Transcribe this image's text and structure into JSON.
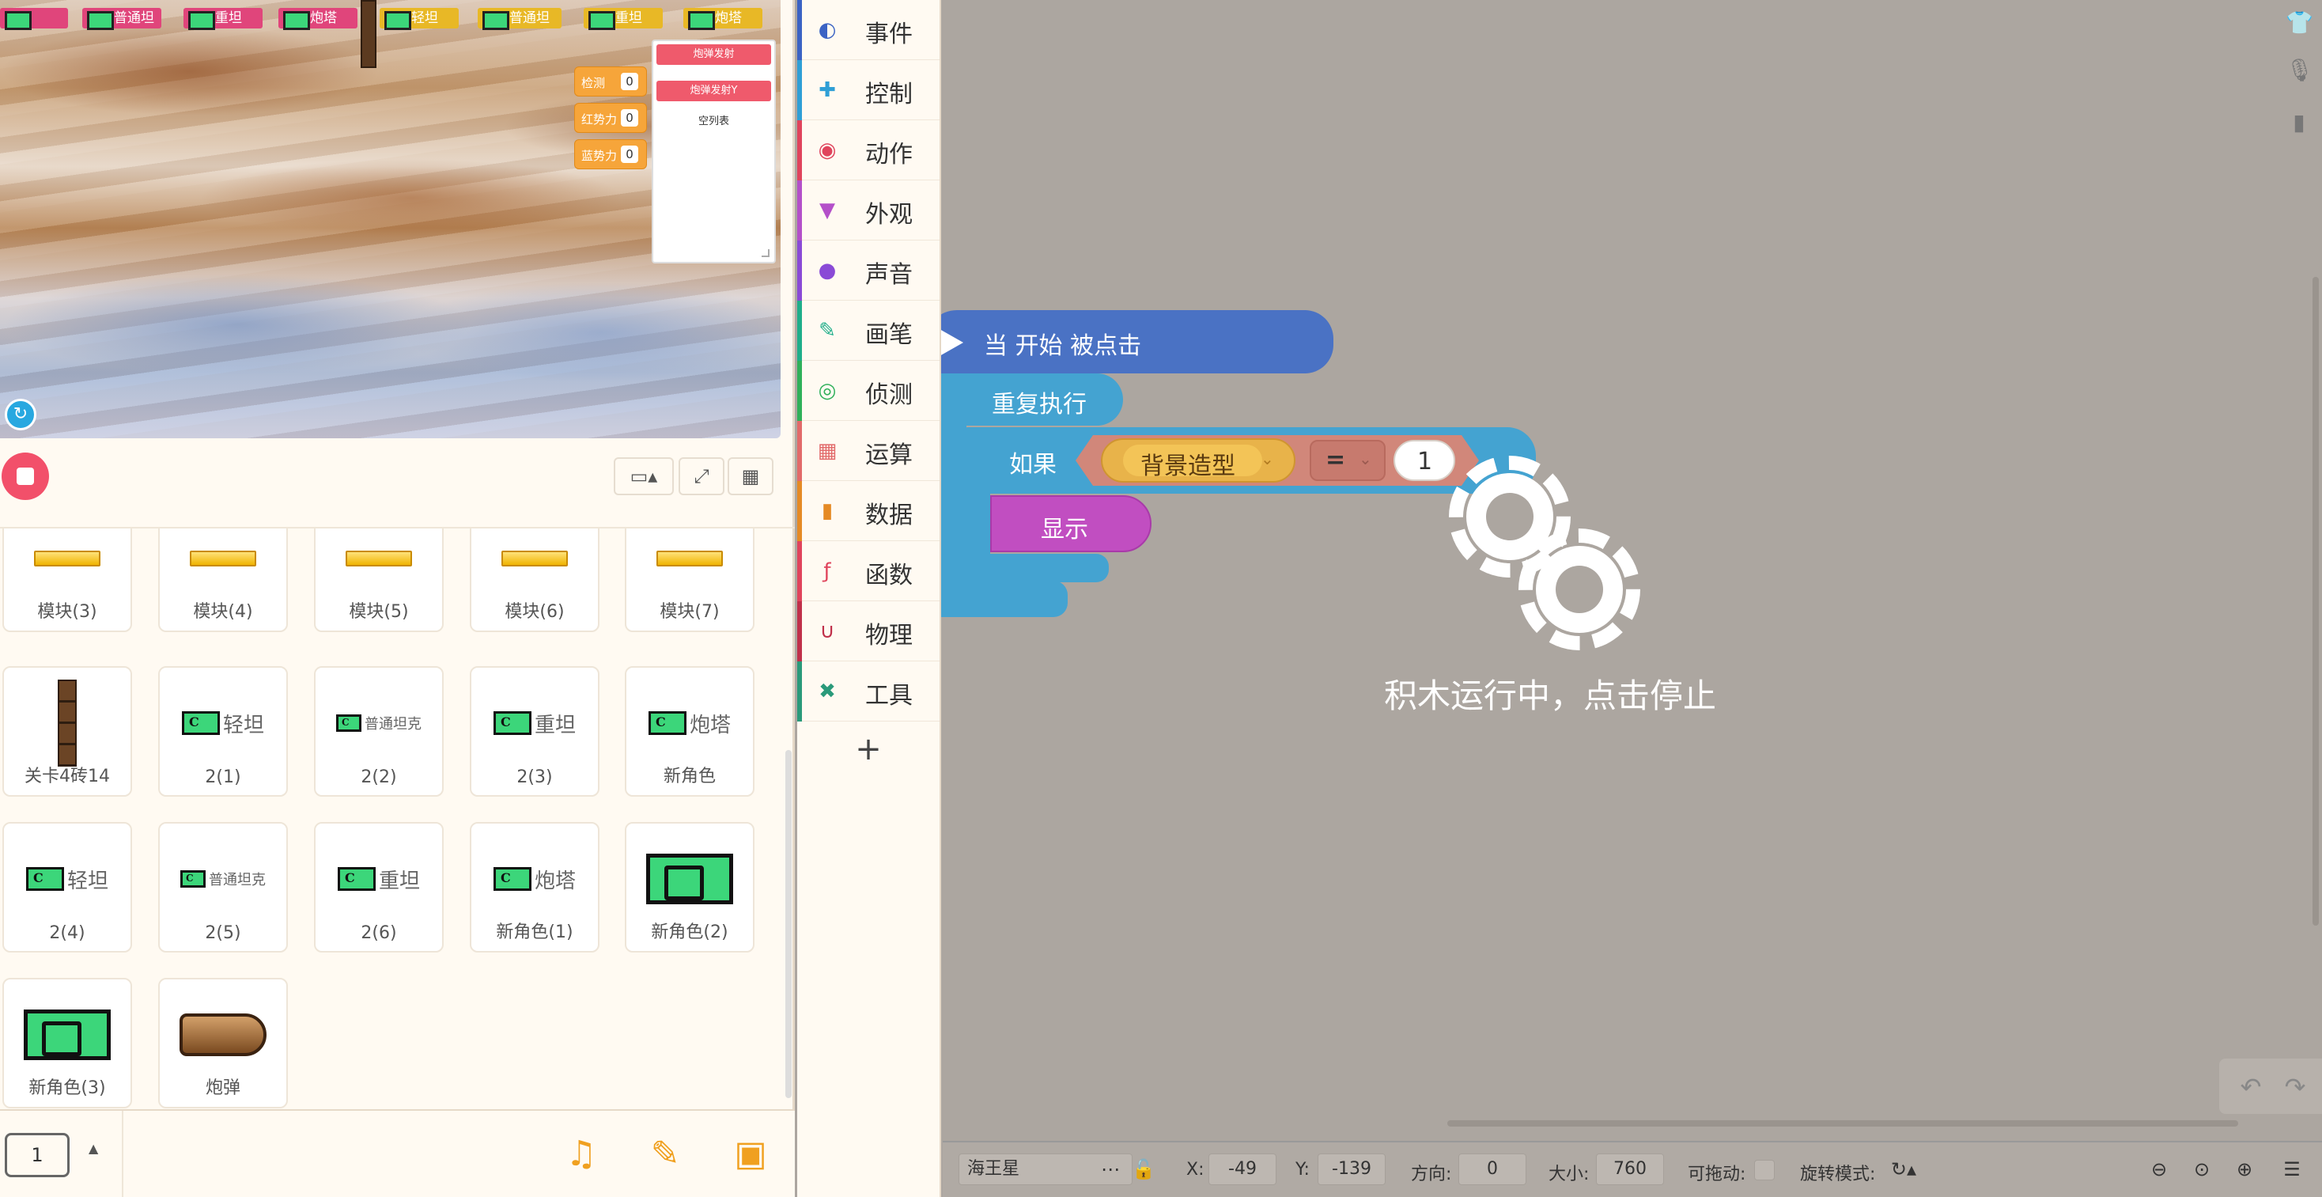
{
  "stage": {
    "top_sprites": [
      {
        "label": "",
        "style": "red"
      },
      {
        "label": "普通坦",
        "style": "red"
      },
      {
        "label": "重坦",
        "style": "red"
      },
      {
        "label": "炮塔",
        "style": "red"
      },
      {
        "label": "轻坦",
        "style": "yel"
      },
      {
        "label": "普通坦",
        "style": "yel"
      },
      {
        "label": "重坦",
        "style": "yel"
      },
      {
        "label": "炮塔",
        "style": "yel"
      }
    ],
    "monitors": [
      {
        "label": "检测",
        "value": "0"
      },
      {
        "label": "红势力",
        "value": "0"
      },
      {
        "label": "蓝势力",
        "value": "0"
      }
    ],
    "list_monitor": {
      "btn1": "炮弹发射",
      "btn2": "炮弹发射Y",
      "empty": "空列表"
    }
  },
  "sprites": [
    {
      "name": "模块(3)",
      "kind": "gold"
    },
    {
      "name": "模块(4)",
      "kind": "gold"
    },
    {
      "name": "模块(5)",
      "kind": "gold"
    },
    {
      "name": "模块(6)",
      "kind": "gold"
    },
    {
      "name": "模块(7)",
      "kind": "gold"
    },
    {
      "name": "关卡4砖14",
      "kind": "brick"
    },
    {
      "name": "2(1)",
      "kind": "tank",
      "tank_label": "轻坦"
    },
    {
      "name": "2(2)",
      "kind": "tank-sm",
      "tank_label": "普通坦克"
    },
    {
      "name": "2(3)",
      "kind": "tank",
      "tank_label": "重坦"
    },
    {
      "name": "新角色",
      "kind": "tank",
      "tank_label": "炮塔"
    },
    {
      "name": "2(4)",
      "kind": "tank",
      "tank_label": "轻坦"
    },
    {
      "name": "2(5)",
      "kind": "tank-sm",
      "tank_label": "普通坦克"
    },
    {
      "name": "2(6)",
      "kind": "tank",
      "tank_label": "重坦"
    },
    {
      "name": "新角色(1)",
      "kind": "tank",
      "tank_label": "炮塔"
    },
    {
      "name": "新角色(2)",
      "kind": "tank-big"
    },
    {
      "name": "新角色(3)",
      "kind": "tank-big"
    },
    {
      "name": "炮弹",
      "kind": "shell"
    }
  ],
  "bottom_bar": {
    "page": "1"
  },
  "categories": [
    {
      "label": "事件",
      "color": "#3b63c4",
      "icon": "toggle-icon"
    },
    {
      "label": "控制",
      "color": "#2f9fd6",
      "icon": "gamepad-icon"
    },
    {
      "label": "动作",
      "color": "#e0445c",
      "icon": "ghost-icon"
    },
    {
      "label": "外观",
      "color": "#b44fc9",
      "icon": "shirt-icon"
    },
    {
      "label": "声音",
      "color": "#8a4ad6",
      "icon": "mic-icon"
    },
    {
      "label": "画笔",
      "color": "#1fae8a",
      "icon": "pen-icon"
    },
    {
      "label": "侦测",
      "color": "#2fb05a",
      "icon": "radar-icon"
    },
    {
      "label": "运算",
      "color": "#e26a6a",
      "icon": "calculator-icon"
    },
    {
      "label": "数据",
      "color": "#e58a25",
      "icon": "chart-icon"
    },
    {
      "label": "函数",
      "color": "#e0445c",
      "icon": "function-icon"
    },
    {
      "label": "物理",
      "color": "#c0304a",
      "icon": "magnet-icon"
    },
    {
      "label": "工具",
      "color": "#2a9a7a",
      "icon": "tools-icon"
    }
  ],
  "blocks": {
    "hat": "当 开始 被点击",
    "repeat": "重复执行",
    "if": "如果",
    "backdrop": "背景造型",
    "op": "=",
    "value": "1",
    "show": "显示"
  },
  "run_overlay": "积木运行中，点击停止",
  "status": {
    "sprite_name": "海王星",
    "x_label": "X:",
    "x": "-49",
    "y_label": "Y:",
    "y": "-139",
    "dir_label": "方向:",
    "dir": "0",
    "size_label": "大小:",
    "size": "760",
    "drag_label": "可拖动:",
    "rot_label": "旋转模式:"
  }
}
